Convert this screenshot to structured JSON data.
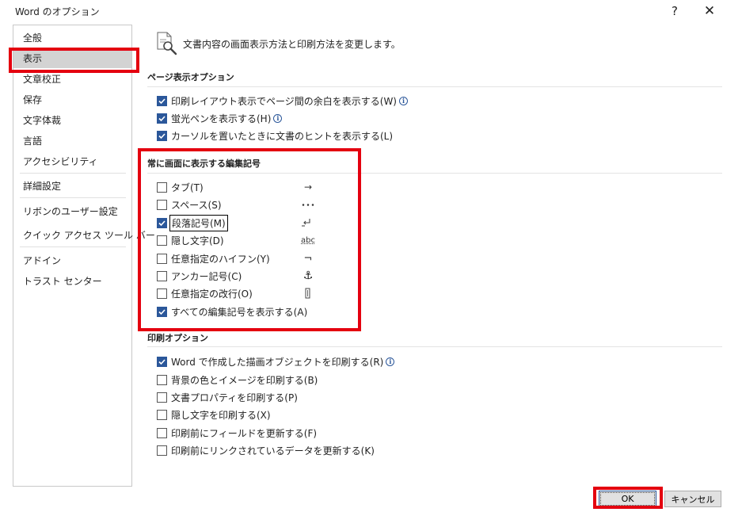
{
  "window": {
    "title": "Word のオプション",
    "help_label": "?",
    "close_label": "✕"
  },
  "sidebar": {
    "items": [
      {
        "label": "全般"
      },
      {
        "label": "表示"
      },
      {
        "label": "文章校正"
      },
      {
        "label": "保存"
      },
      {
        "label": "文字体裁"
      },
      {
        "label": "言語"
      },
      {
        "label": "アクセシビリティ"
      },
      {
        "label": "詳細設定"
      },
      {
        "label": "リボンのユーザー設定"
      },
      {
        "label": "クイック アクセス ツール バー"
      },
      {
        "label": "アドイン"
      },
      {
        "label": "トラスト センター"
      }
    ],
    "selected": "表示"
  },
  "header": {
    "text": "文書内容の画面表示方法と印刷方法を変更します。",
    "icon": "document-magnifier-icon"
  },
  "page_display": {
    "title": "ページ表示オプション",
    "options": [
      {
        "label": "印刷レイアウト表示でページ間の余白を表示する(W)",
        "checked": true,
        "info": true
      },
      {
        "label": "蛍光ペンを表示する(H)",
        "checked": true,
        "info": true
      },
      {
        "label": "カーソルを置いたときに文書のヒントを表示する(L)",
        "checked": true,
        "info": false
      }
    ]
  },
  "formatting_marks": {
    "title": "常に画面に表示する編集記号",
    "options": [
      {
        "label": "タブ(T)",
        "checked": false,
        "symbol": "→"
      },
      {
        "label": "スペース(S)",
        "checked": false,
        "symbol": "･･･"
      },
      {
        "label": "段落記号(M)",
        "checked": true,
        "symbol": "paragraph-mark-icon",
        "focused": true
      },
      {
        "label": "隠し文字(D)",
        "checked": false,
        "symbol": "abc"
      },
      {
        "label": "任意指定のハイフン(Y)",
        "checked": false,
        "symbol": "¬"
      },
      {
        "label": "アンカー記号(C)",
        "checked": false,
        "symbol": "⚓"
      },
      {
        "label": "任意指定の改行(O)",
        "checked": false,
        "symbol": "optional-break-icon"
      },
      {
        "label": "すべての編集記号を表示する(A)",
        "checked": true
      }
    ]
  },
  "print_options": {
    "title": "印刷オプション",
    "options": [
      {
        "label": "Word で作成した描画オブジェクトを印刷する(R)",
        "checked": true,
        "info": true
      },
      {
        "label": "背景の色とイメージを印刷する(B)",
        "checked": false
      },
      {
        "label": "文書プロパティを印刷する(P)",
        "checked": false
      },
      {
        "label": "隠し文字を印刷する(X)",
        "checked": false
      },
      {
        "label": "印刷前にフィールドを更新する(F)",
        "checked": false
      },
      {
        "label": "印刷前にリンクされているデータを更新する(K)",
        "checked": false
      }
    ]
  },
  "buttons": {
    "ok_label": "OK",
    "cancel_label": "キャンセル"
  },
  "colors": {
    "accent": "#2b579a",
    "highlight": "#e4000f",
    "selected_nav": "#d3d3d3"
  }
}
